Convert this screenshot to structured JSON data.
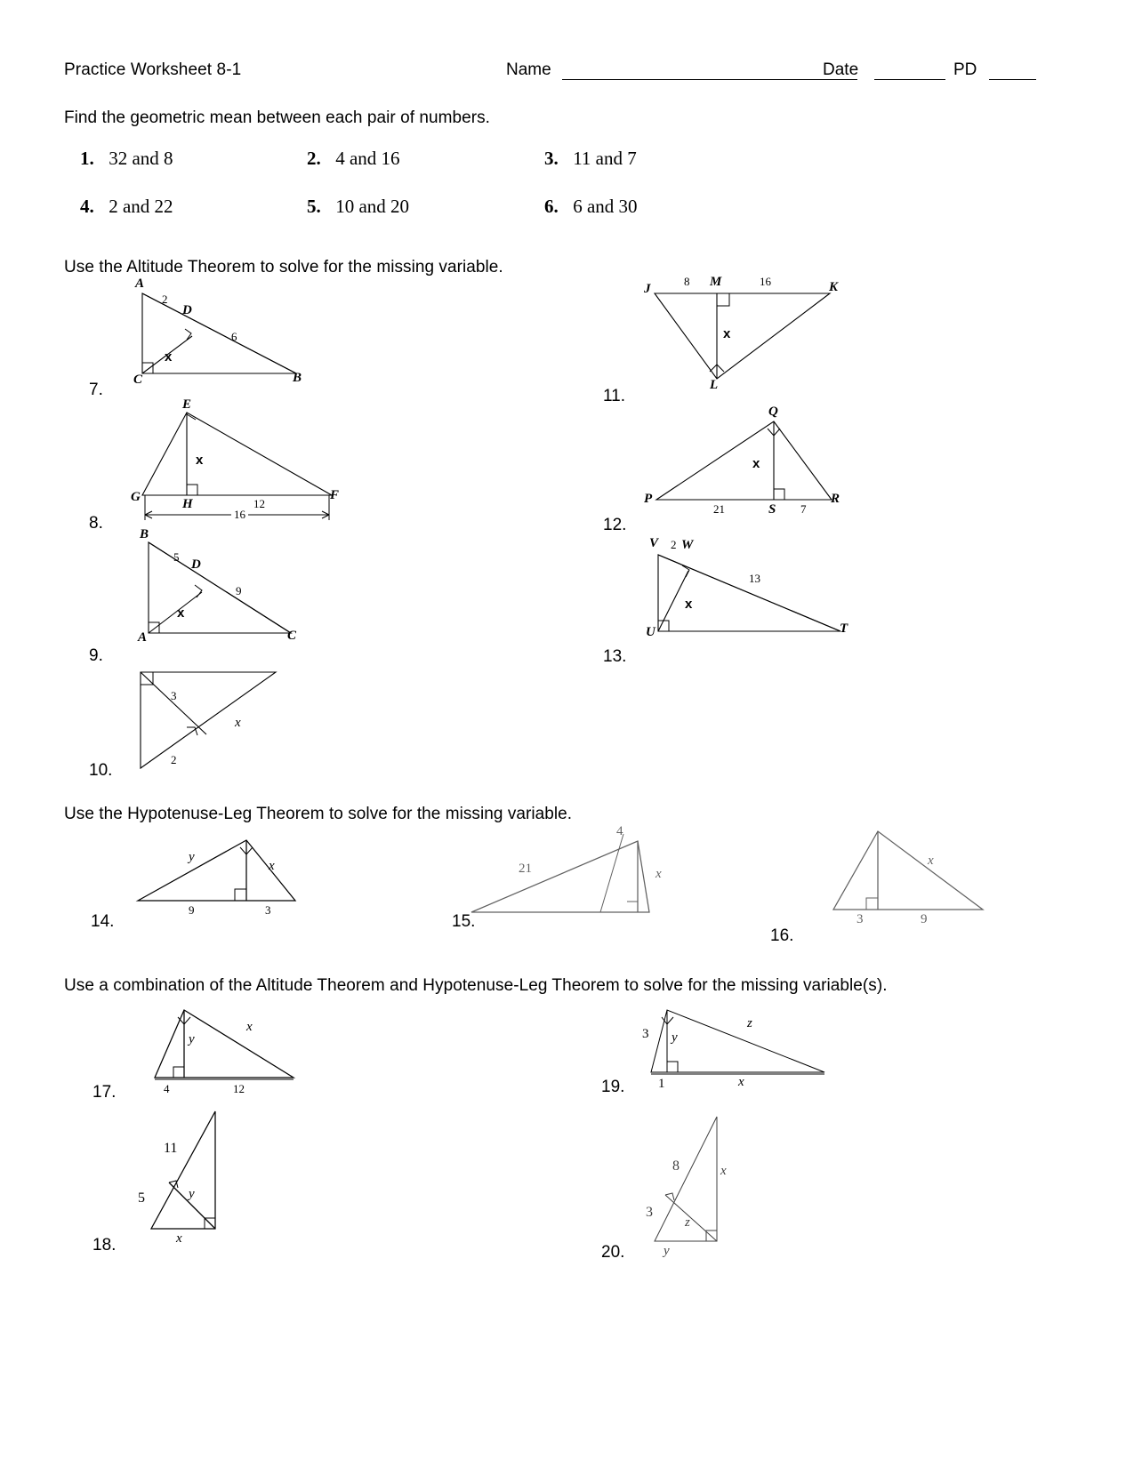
{
  "header": {
    "title": "Practice Worksheet 8-1",
    "name_label": "Name",
    "name_value": "",
    "date_label": "Date",
    "date_value": "",
    "pd_label": "PD",
    "pd_value": ""
  },
  "sections": {
    "geometric_mean": "Find the geometric mean between each pair of numbers.",
    "altitude": "Use the Altitude Theorem to solve for the missing variable.",
    "hypotenuse_leg": "Use the Hypotenuse-Leg Theorem to solve for the missing variable.",
    "combination": "Use a combination of the Altitude Theorem and Hypotenuse-Leg Theorem to solve for the missing variable(s)."
  },
  "geometric_mean_problems": [
    {
      "number": "1.",
      "text": "32 and 8"
    },
    {
      "number": "2.",
      "text": "4 and 16"
    },
    {
      "number": "3.",
      "text": "11 and 7"
    },
    {
      "number": "4.",
      "text": "2 and 22"
    },
    {
      "number": "5.",
      "text": "10 and 20"
    },
    {
      "number": "6.",
      "text": "6 and 30"
    }
  ],
  "figures": {
    "f7": {
      "number": "7.",
      "labels": [
        "A",
        "D",
        "C",
        "B"
      ],
      "values": [
        "2",
        "6",
        "x"
      ]
    },
    "f8": {
      "number": "8.",
      "labels": [
        "E",
        "G",
        "H",
        "F"
      ],
      "values": [
        "x",
        "12",
        "16"
      ]
    },
    "f9": {
      "number": "9.",
      "labels": [
        "B",
        "D",
        "A",
        "C"
      ],
      "values": [
        "5",
        "9",
        "x"
      ]
    },
    "f10": {
      "number": "10.",
      "values": [
        "3",
        "x",
        "2"
      ]
    },
    "f11": {
      "number": "11.",
      "labels": [
        "J",
        "M",
        "K",
        "L"
      ],
      "values": [
        "8",
        "16",
        "x"
      ]
    },
    "f12": {
      "number": "12.",
      "labels": [
        "Q",
        "P",
        "S",
        "R"
      ],
      "values": [
        "x",
        "21",
        "7"
      ]
    },
    "f13": {
      "number": "13.",
      "labels": [
        "V",
        "W",
        "U",
        "T"
      ],
      "values": [
        "2",
        "13",
        "x"
      ]
    },
    "f14": {
      "number": "14.",
      "values": [
        "y",
        "x",
        "9",
        "3"
      ]
    },
    "f15": {
      "number": "15.",
      "values": [
        "21",
        "4",
        "x"
      ]
    },
    "f16": {
      "number": "16.",
      "values": [
        "x",
        "3",
        "9"
      ]
    },
    "f17": {
      "number": "17.",
      "values": [
        "y",
        "x",
        "4",
        "12"
      ]
    },
    "f18": {
      "number": "18.",
      "values": [
        "11",
        "5",
        "y",
        "x"
      ]
    },
    "f19": {
      "number": "19.",
      "values": [
        "3",
        "y",
        "z",
        "1",
        "x"
      ]
    },
    "f20": {
      "number": "20.",
      "values": [
        "8",
        "x",
        "3",
        "z",
        "y"
      ]
    }
  }
}
